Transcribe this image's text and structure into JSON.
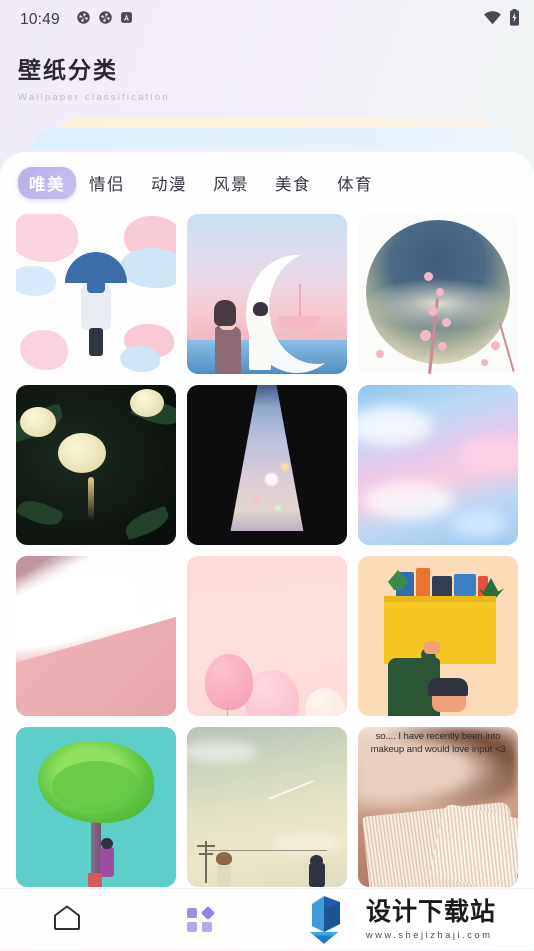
{
  "status_bar": {
    "time": "10:49",
    "left_icons": [
      "sync-circle-icon",
      "sync-circle-icon",
      "app-badge-a-icon"
    ],
    "app_badge_letter": "A",
    "right_icons": [
      "wifi-icon",
      "battery-charging-icon"
    ]
  },
  "header": {
    "title": "壁纸分类",
    "subtitle": "Wallpaper classification"
  },
  "tabs": [
    {
      "label": "唯美",
      "active": true
    },
    {
      "label": "情侣",
      "active": false
    },
    {
      "label": "动漫",
      "active": false
    },
    {
      "label": "风景",
      "active": false
    },
    {
      "label": "美食",
      "active": false
    },
    {
      "label": "体育",
      "active": false
    }
  ],
  "wallpapers": [
    {
      "id": 1,
      "name": "umbrella-girl-sakura",
      "caption": ""
    },
    {
      "id": 2,
      "name": "couple-crescent-moon",
      "caption": ""
    },
    {
      "id": 3,
      "name": "moon-cherry-blossom",
      "caption": ""
    },
    {
      "id": 4,
      "name": "white-flowers-dark",
      "caption": ""
    },
    {
      "id": 5,
      "name": "iridescent-veil",
      "caption": ""
    },
    {
      "id": 6,
      "name": "pastel-clouds",
      "caption": ""
    },
    {
      "id": 7,
      "name": "pink-beach-waves",
      "caption": ""
    },
    {
      "id": 8,
      "name": "pink-balloons",
      "caption": ""
    },
    {
      "id": 9,
      "name": "grocery-bag-person",
      "caption": ""
    },
    {
      "id": 10,
      "name": "green-tree-teal",
      "caption": ""
    },
    {
      "id": 11,
      "name": "vintage-sky-figures",
      "caption": ""
    },
    {
      "id": 12,
      "name": "open-book-makeup-quote",
      "caption": "so.... I have recently been into makeup and would love input <3"
    }
  ],
  "bottom_nav": [
    {
      "name": "home-icon",
      "label": ""
    },
    {
      "name": "category-grid-icon",
      "label": ""
    },
    {
      "name": "add-button",
      "label": "+"
    }
  ],
  "watermark": {
    "brand": "设计下载站",
    "url": "www.shejizhaji.com",
    "logo": "download-arrow-logo"
  },
  "colors": {
    "accent": "#a79af0",
    "active_tab_bg": "#b9aee8",
    "sheet_bg": "#fefeff",
    "page_bg": "#f0ebf7",
    "stack_yellow": "#fdf0d8",
    "stack_blue": "#dcf0fb"
  }
}
